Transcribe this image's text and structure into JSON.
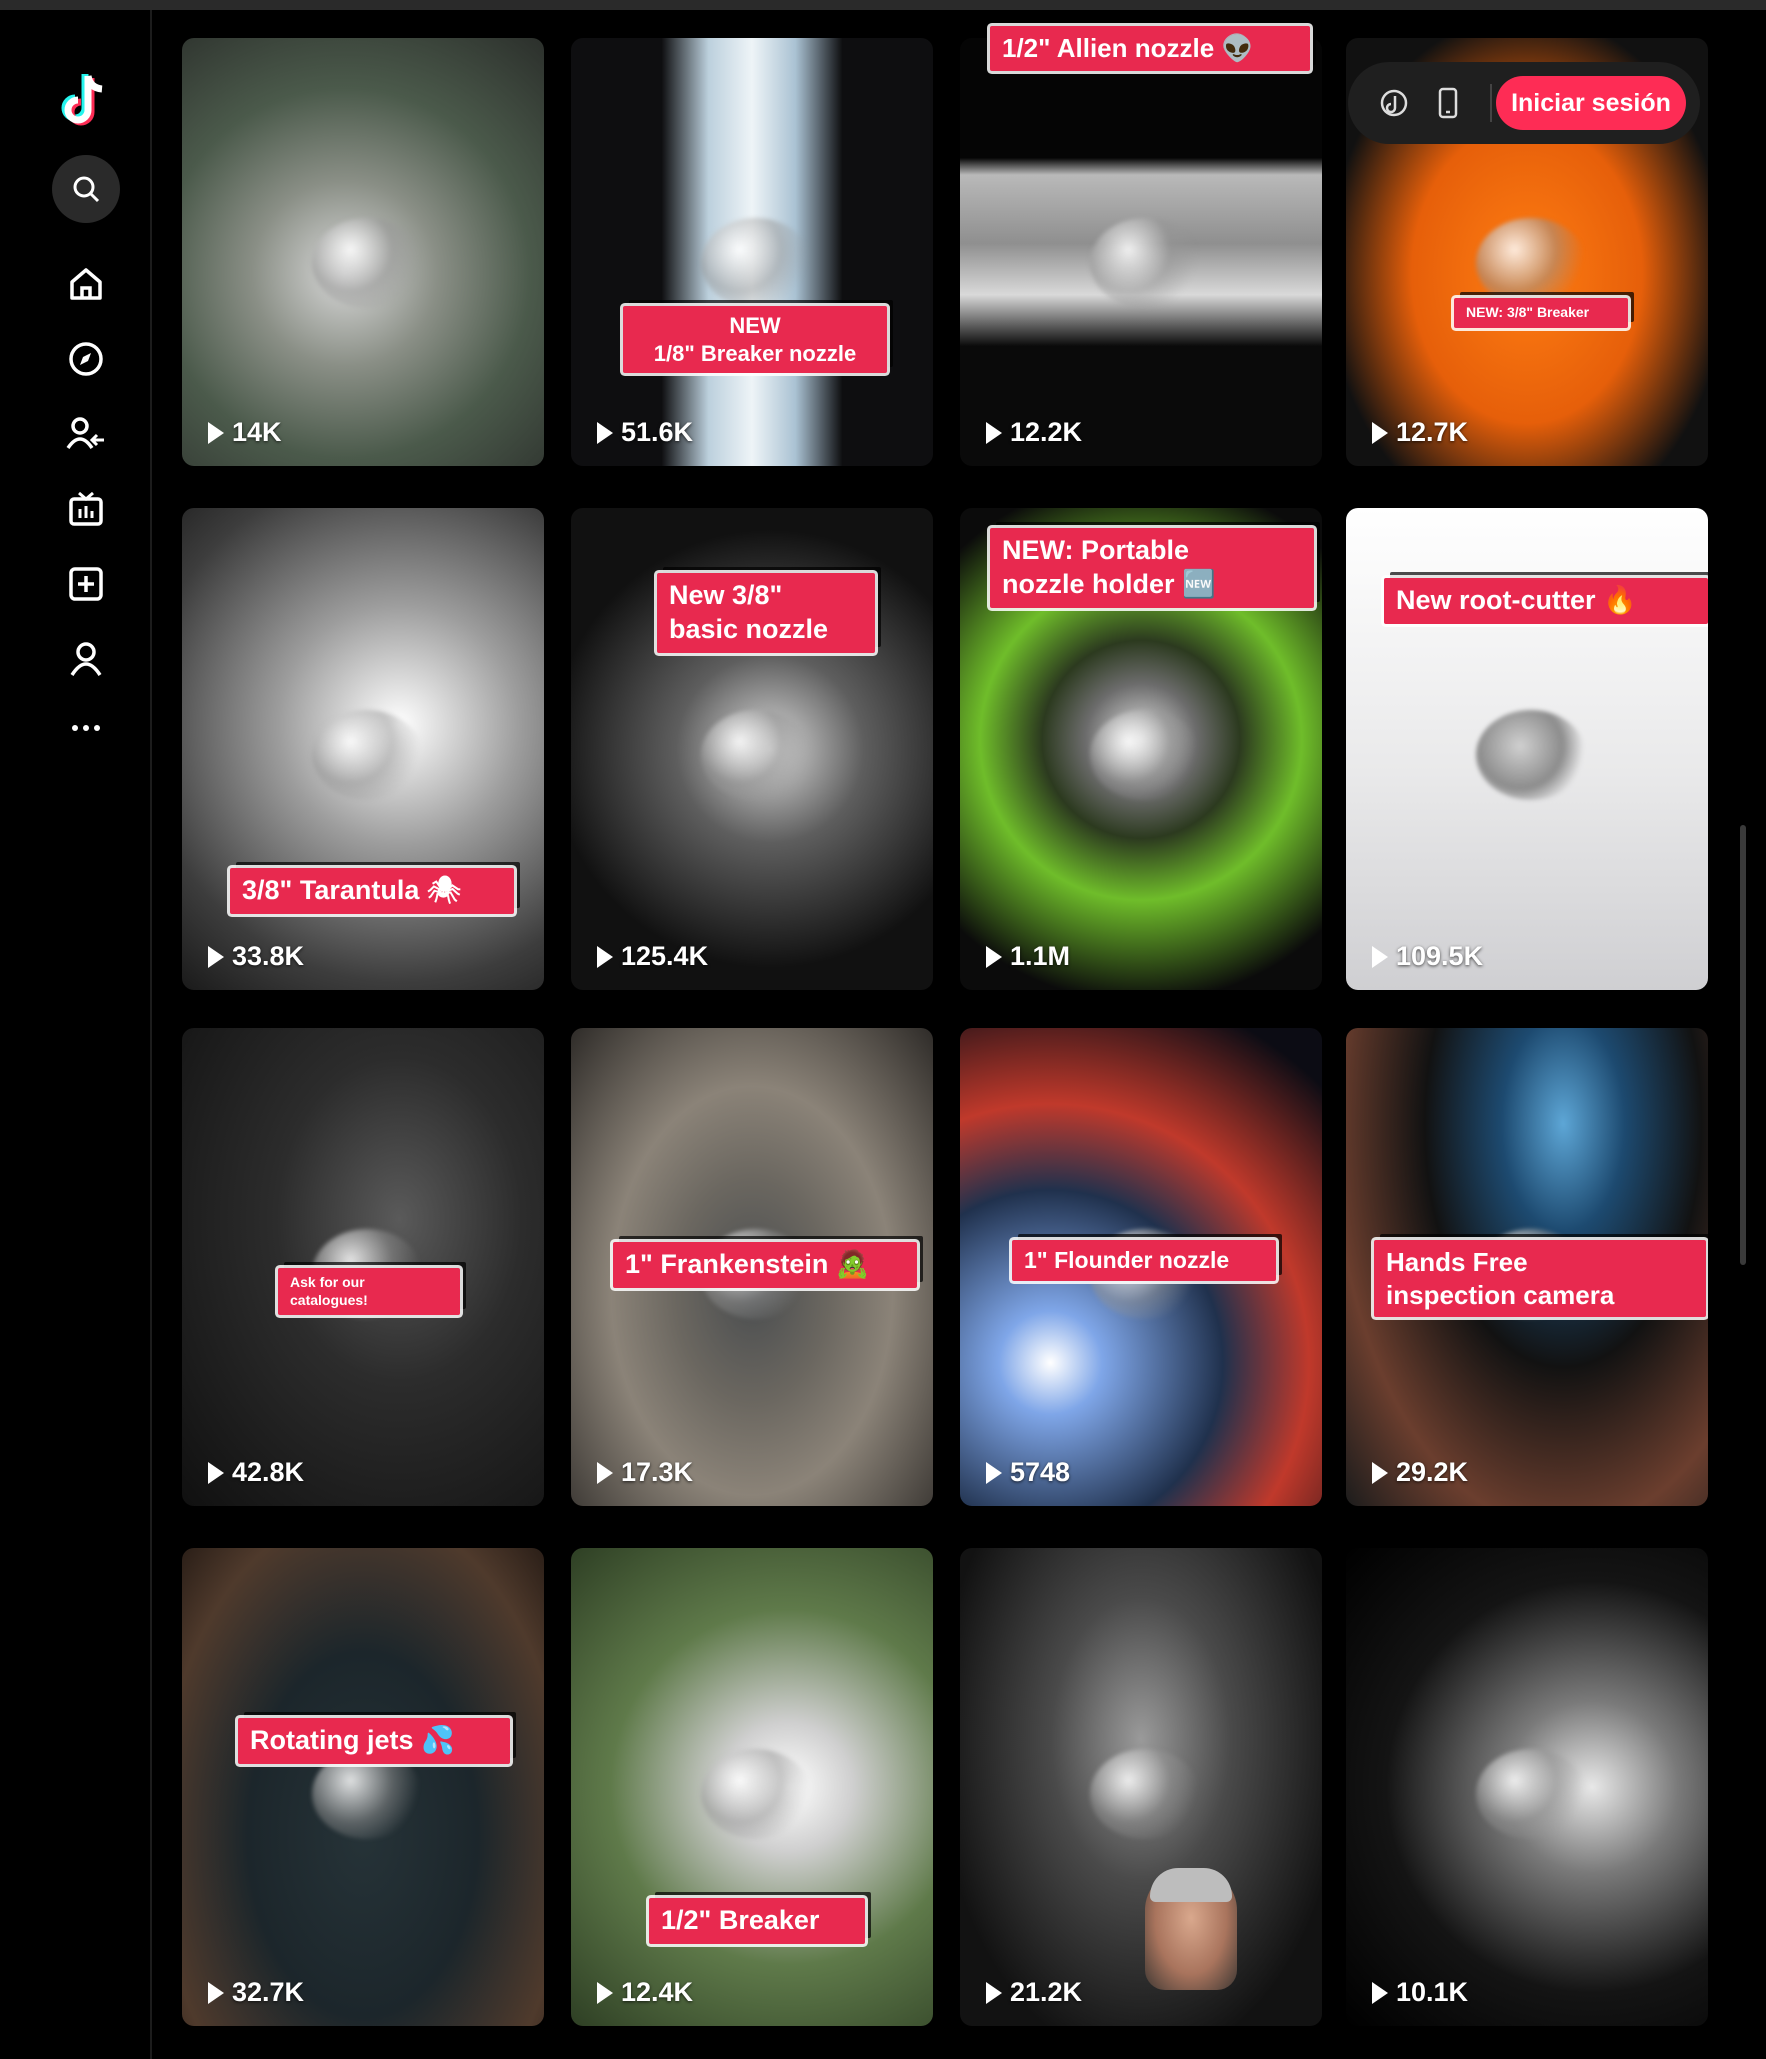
{
  "sidebar": {
    "logo_icon": "tiktok-logo",
    "items": [
      {
        "name": "search",
        "icon": "search-icon"
      },
      {
        "name": "home",
        "icon": "home-icon"
      },
      {
        "name": "explore",
        "icon": "compass-icon"
      },
      {
        "name": "following",
        "icon": "following-icon"
      },
      {
        "name": "live",
        "icon": "live-tv-icon"
      },
      {
        "name": "upload",
        "icon": "plus-square-icon"
      },
      {
        "name": "profile",
        "icon": "user-icon"
      },
      {
        "name": "more",
        "icon": "more-icon"
      }
    ]
  },
  "header": {
    "login_label": "Iniciar sesión",
    "icons": [
      "tiktok-coin-icon",
      "mobile-app-icon"
    ]
  },
  "accent": "#fe2c55",
  "caption_color": "#e8294f",
  "videos": [
    {
      "views": "14K",
      "caption": ""
    },
    {
      "views": "51.6K",
      "caption": "NEW\n1/8\" Breaker nozzle"
    },
    {
      "views": "12.2K",
      "caption": "1/2\" Allien nozzle 👽"
    },
    {
      "views": "12.7K",
      "caption": "NEW: 3/8\" Breaker"
    },
    {
      "views": "33.8K",
      "caption": "3/8\" Tarantula 🕷"
    },
    {
      "views": "125.4K",
      "caption": "New 3/8\"\nbasic nozzle"
    },
    {
      "views": "1.1M",
      "caption": "NEW: Portable\nnozzle holder 🆕"
    },
    {
      "views": "109.5K",
      "caption": "New root-cutter 🔥"
    },
    {
      "views": "42.8K",
      "caption": "Ask for our\ncatalogues!"
    },
    {
      "views": "17.3K",
      "caption": "1\" Frankenstein 🧟"
    },
    {
      "views": "5748",
      "caption": "1\" Flounder nozzle"
    },
    {
      "views": "29.2K",
      "caption": "Hands Free\ninspection camera"
    },
    {
      "views": "32.7K",
      "caption": "Rotating jets 💦"
    },
    {
      "views": "12.4K",
      "caption": "1/2\" Breaker"
    },
    {
      "views": "21.2K",
      "caption": ""
    },
    {
      "views": "10.1K",
      "caption": ""
    }
  ]
}
